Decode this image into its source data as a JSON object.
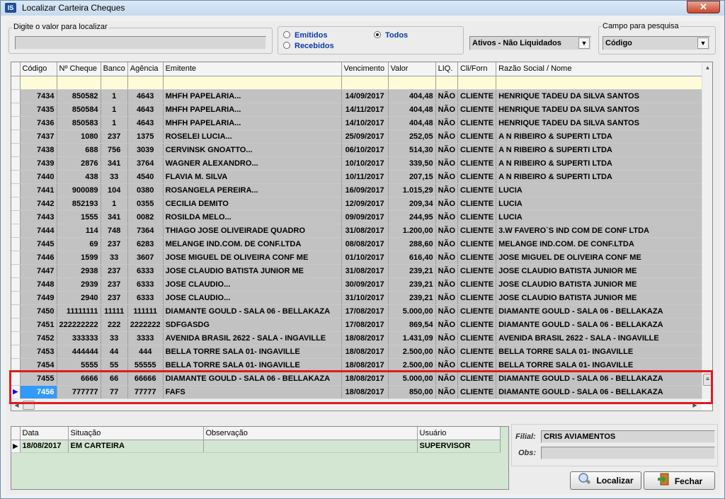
{
  "window": {
    "title": "Localizar Carteira Cheques",
    "app_icon": "IS",
    "close_symbol": "✕"
  },
  "search": {
    "legend": "Digite o valor para localizar",
    "value": ""
  },
  "radios": [
    {
      "label": "Emitidos",
      "checked": false
    },
    {
      "label": "Recebidos",
      "checked": false
    },
    {
      "label": "Todos",
      "checked": true
    }
  ],
  "status_filter": {
    "value": "Ativos - Não Liquidados"
  },
  "field": {
    "legend": "Campo para pesquisa",
    "value": "Código"
  },
  "grid": {
    "columns": [
      "Código",
      "Nº Cheque",
      "Banco",
      "Agência",
      "Emitente",
      "Vencimento",
      "Valor",
      "LIQ.",
      "Cli/Forn",
      "Razão Social / Nome"
    ],
    "rows": [
      [
        "7434",
        "850582",
        "1",
        "4643",
        "MHFH PAPELARIA...",
        "14/09/2017",
        "404,48",
        "NÃO",
        "CLIENTE",
        "HENRIQUE TADEU DA SILVA SANTOS"
      ],
      [
        "7435",
        "850584",
        "1",
        "4643",
        "MHFH PAPELARIA...",
        "14/11/2017",
        "404,48",
        "NÃO",
        "CLIENTE",
        "HENRIQUE TADEU DA SILVA SANTOS"
      ],
      [
        "7436",
        "850583",
        "1",
        "4643",
        "MHFH PAPELARIA...",
        "14/10/2017",
        "404,48",
        "NÃO",
        "CLIENTE",
        "HENRIQUE TADEU DA SILVA SANTOS"
      ],
      [
        "7437",
        "1080",
        "237",
        "1375",
        "ROSELEI LUCIA...",
        "25/09/2017",
        "252,05",
        "NÃO",
        "CLIENTE",
        "A N RIBEIRO & SUPERTI LTDA"
      ],
      [
        "7438",
        "688",
        "756",
        "3039",
        "CERVINSK GNOATTO...",
        "06/10/2017",
        "514,30",
        "NÃO",
        "CLIENTE",
        "A N RIBEIRO & SUPERTI LTDA"
      ],
      [
        "7439",
        "2876",
        "341",
        "3764",
        "WAGNER ALEXANDRO...",
        "10/10/2017",
        "339,50",
        "NÃO",
        "CLIENTE",
        "A N RIBEIRO & SUPERTI LTDA"
      ],
      [
        "7440",
        "438",
        "33",
        "4540",
        "FLAVIA M. SILVA",
        "10/11/2017",
        "207,15",
        "NÃO",
        "CLIENTE",
        "A N RIBEIRO & SUPERTI LTDA"
      ],
      [
        "7441",
        "900089",
        "104",
        "0380",
        "ROSANGELA PEREIRA...",
        "16/09/2017",
        "1.015,29",
        "NÃO",
        "CLIENTE",
        "LUCIA"
      ],
      [
        "7442",
        "852193",
        "1",
        "0355",
        "CECILIA DEMITO",
        "12/09/2017",
        "209,34",
        "NÃO",
        "CLIENTE",
        "LUCIA"
      ],
      [
        "7443",
        "1555",
        "341",
        "0082",
        "ROSILDA MELO...",
        "09/09/2017",
        "244,95",
        "NÃO",
        "CLIENTE",
        "LUCIA"
      ],
      [
        "7444",
        "114",
        "748",
        "7364",
        "THIAGO JOSE OLIVEIRADE QUADRO",
        "31/08/2017",
        "1.200,00",
        "NÃO",
        "CLIENTE",
        "3.W FAVERO`S IND COM DE CONF LTDA"
      ],
      [
        "7445",
        "69",
        "237",
        "6283",
        "MELANGE IND.COM. DE CONF.LTDA",
        "08/08/2017",
        "288,60",
        "NÃO",
        "CLIENTE",
        "MELANGE IND.COM. DE CONF.LTDA"
      ],
      [
        "7446",
        "1599",
        "33",
        "3607",
        "JOSE MIGUEL DE OLIVEIRA CONF ME",
        "01/10/2017",
        "616,40",
        "NÃO",
        "CLIENTE",
        "JOSE MIGUEL DE OLIVEIRA CONF ME"
      ],
      [
        "7447",
        "2938",
        "237",
        "6333",
        "JOSE CLAUDIO BATISTA JUNIOR ME",
        "31/08/2017",
        "239,21",
        "NÃO",
        "CLIENTE",
        "JOSE CLAUDIO BATISTA JUNIOR ME"
      ],
      [
        "7448",
        "2939",
        "237",
        "6333",
        "JOSE CLAUDIO...",
        "30/09/2017",
        "239,21",
        "NÃO",
        "CLIENTE",
        "JOSE CLAUDIO BATISTA JUNIOR ME"
      ],
      [
        "7449",
        "2940",
        "237",
        "6333",
        "JOSE CLAUDIO...",
        "31/10/2017",
        "239,21",
        "NÃO",
        "CLIENTE",
        "JOSE CLAUDIO BATISTA JUNIOR ME"
      ],
      [
        "7450",
        "11111111",
        "11111",
        "111111",
        "DIAMANTE GOULD - SALA 06 - BELLAKAZA",
        "17/08/2017",
        "5.000,00",
        "NÃO",
        "CLIENTE",
        "DIAMANTE GOULD - SALA 06 - BELLAKAZA"
      ],
      [
        "7451",
        "222222222",
        "222",
        "2222222",
        "SDFGASDG",
        "17/08/2017",
        "869,54",
        "NÃO",
        "CLIENTE",
        "DIAMANTE GOULD - SALA 06 - BELLAKAZA"
      ],
      [
        "7452",
        "333333",
        "33",
        "3333",
        "AVENIDA  BRASIL  2622 - SALA - INGAVILLE",
        "18/08/2017",
        "1.431,09",
        "NÃO",
        "CLIENTE",
        "AVENIDA  BRASIL  2622 - SALA - INGAVILLE"
      ],
      [
        "7453",
        "444444",
        "44",
        "444",
        "BELLA TORRE SALA 01- INGAVILLE",
        "18/08/2017",
        "2.500,00",
        "NÃO",
        "CLIENTE",
        "BELLA TORRE SALA 01- INGAVILLE"
      ],
      [
        "7454",
        "5555",
        "55",
        "55555",
        "BELLA TORRE SALA 01- INGAVILLE",
        "18/08/2017",
        "2.500,00",
        "NÃO",
        "CLIENTE",
        "BELLA TORRE SALA 01- INGAVILLE"
      ],
      [
        "7455",
        "6666",
        "66",
        "66666",
        "DIAMANTE GOULD - SALA 06 - BELLAKAZA",
        "18/08/2017",
        "5.000,00",
        "NÃO",
        "CLIENTE",
        "DIAMANTE GOULD - SALA 06 - BELLAKAZA"
      ],
      [
        "7456",
        "777777",
        "77",
        "77777",
        "FAFS",
        "18/08/2017",
        "850,00",
        "NÃO",
        "CLIENTE",
        "DIAMANTE GOULD - SALA 06 - BELLAKAZA"
      ]
    ],
    "selected_index": 22
  },
  "history": {
    "columns": [
      "Data",
      "Situação",
      "Observação",
      "Usuário"
    ],
    "rows": [
      [
        "18/08/2017",
        "EM CARTEIRA",
        "",
        "SUPERVISOR"
      ]
    ]
  },
  "info": {
    "filial_label": "Filial:",
    "filial_value": "CRIS AVIAMENTOS",
    "obs_label": "Obs:",
    "obs_value": ""
  },
  "buttons": {
    "localizar": "Localizar",
    "fechar": "Fechar"
  },
  "colors": {
    "highlight_border": "#e11b22",
    "selection": "#3399ff",
    "grid_row": "#c2c2c2",
    "filter_row": "#fffbd9"
  }
}
